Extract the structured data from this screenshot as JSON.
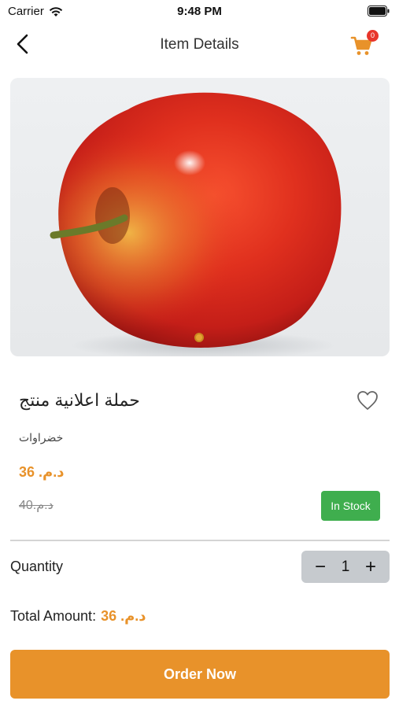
{
  "status_bar": {
    "carrier": "Carrier",
    "time": "9:48 PM"
  },
  "header": {
    "title": "Item Details",
    "cart_count": "0",
    "back_icon": "chevron-left-icon",
    "cart_icon": "shopping-cart-icon"
  },
  "product": {
    "image_subject": "red apple",
    "name": "حملة اعلانية منتج",
    "category": "خضراوات",
    "price": "د.م. 36",
    "old_price": "د.م.40",
    "stock_status": "In Stock"
  },
  "quantity": {
    "label": "Quantity",
    "value": "1",
    "decrement": "−",
    "increment": "+"
  },
  "total": {
    "label": "Total Amount:",
    "value": "د.م. 36"
  },
  "actions": {
    "order_label": "Order Now"
  },
  "colors": {
    "accent": "#e8922a",
    "stock_green": "#3fae4e",
    "badge_red": "#e8352a"
  }
}
